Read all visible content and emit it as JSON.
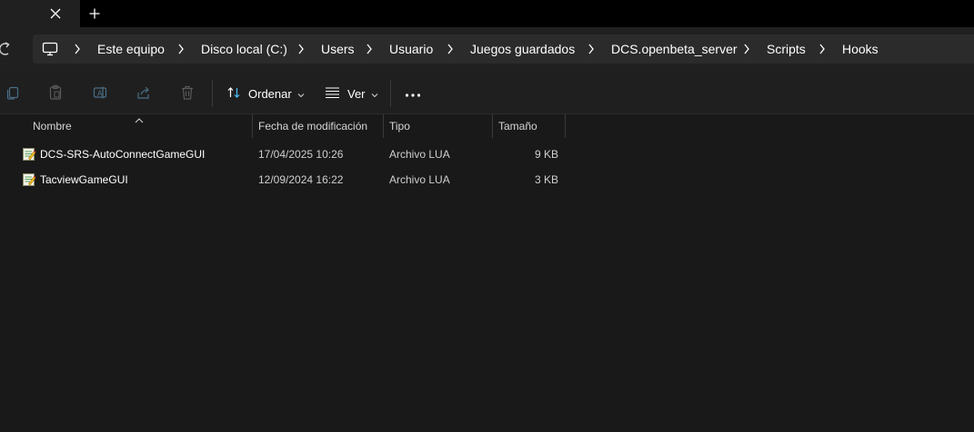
{
  "tabs": {
    "close_label": "✕",
    "new_tab_label": "+"
  },
  "breadcrumb": {
    "items": [
      "Este equipo",
      "Disco local (C:)",
      "Users",
      "Usuario",
      "Juegos guardados",
      "DCS.openbeta_server",
      "Scripts",
      "Hooks"
    ]
  },
  "toolbar": {
    "sort_label": "Ordenar",
    "view_label": "Ver"
  },
  "columns": {
    "name": "Nombre",
    "modified": "Fecha de modificación",
    "type": "Tipo",
    "size": "Tamaño"
  },
  "files": [
    {
      "name": "DCS-SRS-AutoConnectGameGUI",
      "modified": "17/04/2025 10:26",
      "type": "Archivo LUA",
      "size": "9 KB",
      "icon": "lua-file-icon"
    },
    {
      "name": "TacviewGameGUI",
      "modified": "12/09/2024 16:22",
      "type": "Archivo LUA",
      "size": "3 KB",
      "icon": "lua-file-icon"
    }
  ],
  "colors": {
    "background": "#191919",
    "address_bar": "#2b2b2b",
    "toolbar": "#1f1f1f",
    "accent": "#4cc2ff"
  }
}
